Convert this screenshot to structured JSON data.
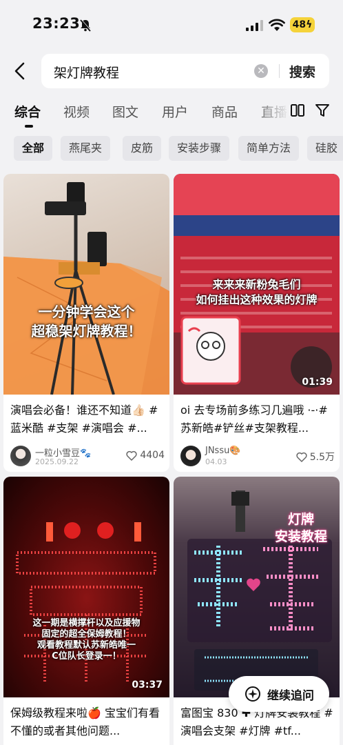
{
  "status": {
    "time": "23:23",
    "battery": "48"
  },
  "search": {
    "query": "架灯牌教程",
    "button": "搜索"
  },
  "tabs": [
    "综合",
    "视频",
    "图文",
    "用户",
    "商品",
    "直播"
  ],
  "chips": [
    "全部",
    "燕尾夹",
    "皮筋",
    "安装步骤",
    "简单方法",
    "硅胶"
  ],
  "cards": [
    {
      "overlay": "一分钟学会这个\n超稳架灯牌教程！",
      "title": "演唱会必备！谁还不知道👍🏻 #蓝米酷 #支架 #演唱会 #...",
      "author": "一粒小雪豆🐾",
      "date": "2025.09.22",
      "likes": "4404",
      "duration": ""
    },
    {
      "overlay": "来来来新粉兔毛们\n如何挂出这种效果的灯牌",
      "title": "oi 去专场前多练习几遍哦 ·-·#苏新皓#铲丝#支架教程...",
      "author": "JNssu🎨",
      "date": "04.03",
      "likes": "5.5万",
      "duration": "01:39"
    },
    {
      "overlay": "这一期是横撑杆以及应援物\n固定的超全保姆教程！\n观看教程默认苏新皓唯一\nC位队长登录一！",
      "title": "保姆级教程来啦🍎 宝宝们有看不懂的或者其他问题...",
      "author": "",
      "date": "",
      "likes": "",
      "duration": "03:37"
    },
    {
      "overlay": "灯牌\n安装教程",
      "title": "富图宝 830 ✚ 灯牌安装教程 #演唱会支架 #灯牌 #tf...",
      "author": "",
      "date": "",
      "likes": "",
      "duration": ""
    }
  ],
  "floating": {
    "label": "继续追问"
  }
}
